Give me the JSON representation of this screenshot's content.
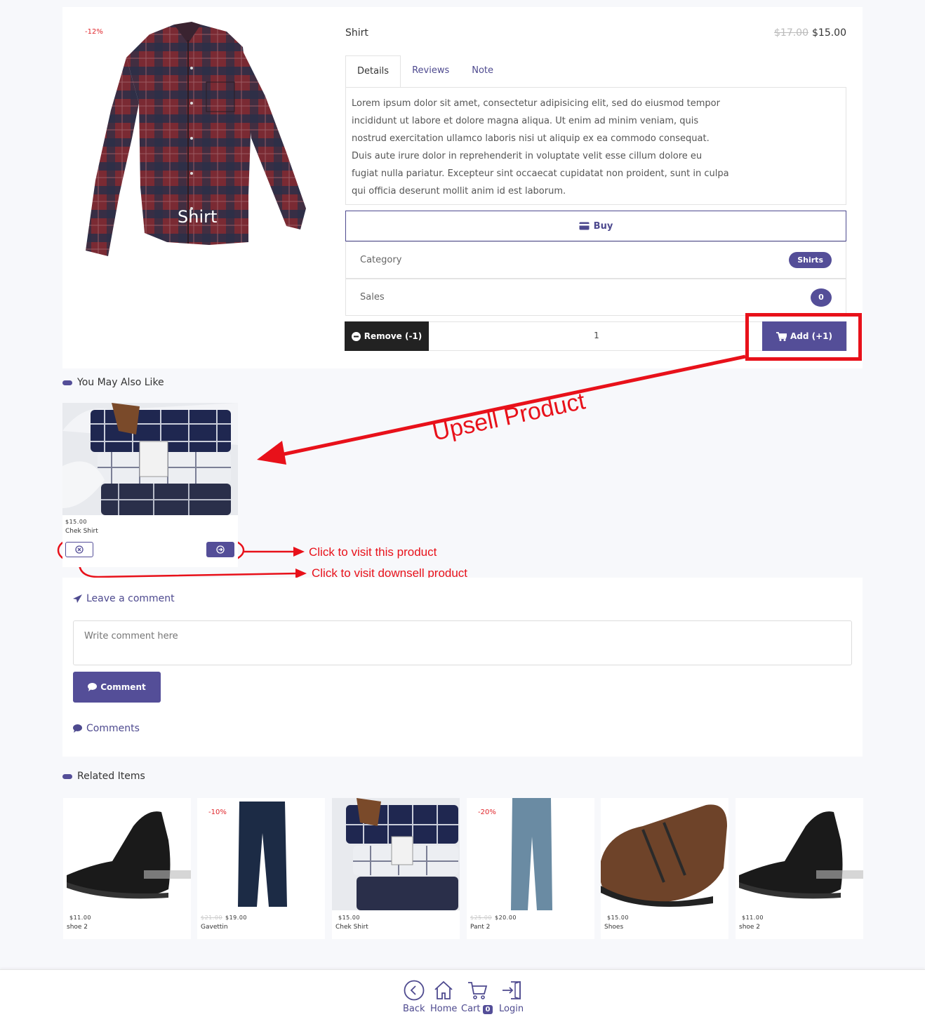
{
  "product": {
    "discount": "-12%",
    "image_caption": "Shirt",
    "title": "Shirt",
    "old_price": "$17.00",
    "price": "$15.00"
  },
  "tabs": [
    {
      "label": "Details",
      "active": true
    },
    {
      "label": "Reviews",
      "active": false
    },
    {
      "label": "Note",
      "active": false
    }
  ],
  "details_text": "Lorem ipsum dolor sit amet, consectetur adipisicing elit, sed do eiusmod tempor incididunt ut labore et dolore magna aliqua. Ut enim ad minim veniam, quis nostrud exercitation ullamco laboris nisi ut aliquip ex ea commodo consequat. Duis aute irure dolor in reprehenderit in voluptate velit esse cillum dolore eu fugiat nulla pariatur. Excepteur sint occaecat cupidatat non proident, sunt in culpa qui officia deserunt mollit anim id est laborum.",
  "buy_label": "Buy",
  "category": {
    "label": "Category",
    "value": "Shirts"
  },
  "sales": {
    "label": "Sales",
    "value": "0"
  },
  "cart_controls": {
    "remove_label": "Remove (-1)",
    "quantity": "1",
    "add_label": "Add (+1)"
  },
  "annotations": {
    "upsell": "Upsell Product",
    "visit_product": "Click to visit this product",
    "visit_downsell": "Click to visit downsell product"
  },
  "you_may_also_like": {
    "heading": "You May Also Like",
    "item": {
      "price": "$15.00",
      "name": "Chek Shirt"
    }
  },
  "comments": {
    "leave_heading": "Leave a comment",
    "placeholder": "Write comment here",
    "button_label": "Comment",
    "list_heading": "Comments"
  },
  "related": {
    "heading": "Related Items",
    "items": [
      {
        "name": "shoe 2",
        "old_price": "",
        "price": "$11.00",
        "discount": "",
        "image": "black-shoe"
      },
      {
        "name": "Gavettin",
        "old_price": "$21.00",
        "price": "$19.00",
        "discount": "-10%",
        "image": "navy-pants"
      },
      {
        "name": "Chek Shirt",
        "old_price": "",
        "price": "$15.00",
        "discount": "",
        "image": "folded-shirts"
      },
      {
        "name": "Pant 2",
        "old_price": "$25.00",
        "price": "$20.00",
        "discount": "-20%",
        "image": "blue-pants"
      },
      {
        "name": "Shoes",
        "old_price": "",
        "price": "$15.00",
        "discount": "",
        "image": "brown-shoe"
      },
      {
        "name": "shoe 2",
        "old_price": "",
        "price": "$11.00",
        "discount": "",
        "image": "black-shoe"
      }
    ]
  },
  "footer_nav": {
    "back": "Back",
    "home": "Home",
    "cart": "Cart",
    "cart_count": "0",
    "login": "Login"
  },
  "colors": {
    "accent": "#544e98",
    "annotation": "#e8111a",
    "discount": "#e0262b"
  }
}
